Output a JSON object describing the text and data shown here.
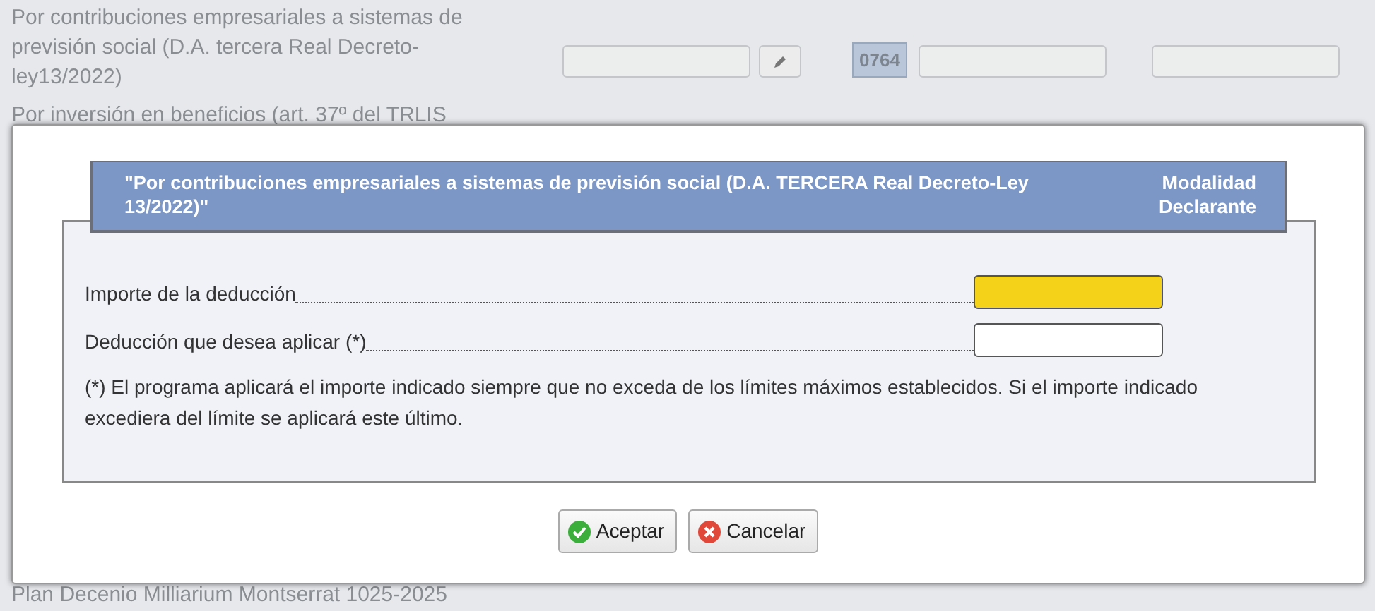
{
  "background_rows": [
    {
      "label": "Por contribuciones empresariales a sistemas de previsión social (D.A. tercera Real Decreto-ley13/2022)",
      "code": "0764"
    },
    {
      "label": "Por inversión en beneficios (art. 37º del TRLIS"
    },
    {
      "label": "Plan Decenio Milliarium Montserrat 1025-2025"
    }
  ],
  "dialog": {
    "title": "\"Por contribuciones empresariales a sistemas de previsión social (D.A. TERCERA Real Decreto-Ley 13/2022)\"",
    "modality": "Modalidad Declarante",
    "fields": [
      {
        "label": "Importe de la deducción",
        "highlighted": true
      },
      {
        "label": "Deducción que desea aplicar (*)",
        "highlighted": false
      }
    ],
    "note": "(*) El programa aplicará el importe indicado siempre que no exceda de los límites máximos establecidos. Si el importe indicado excediera del límite se aplicará este último.",
    "buttons": [
      {
        "label": "Aceptar",
        "kind": "ok"
      },
      {
        "label": "Cancelar",
        "kind": "cancel"
      }
    ]
  }
}
